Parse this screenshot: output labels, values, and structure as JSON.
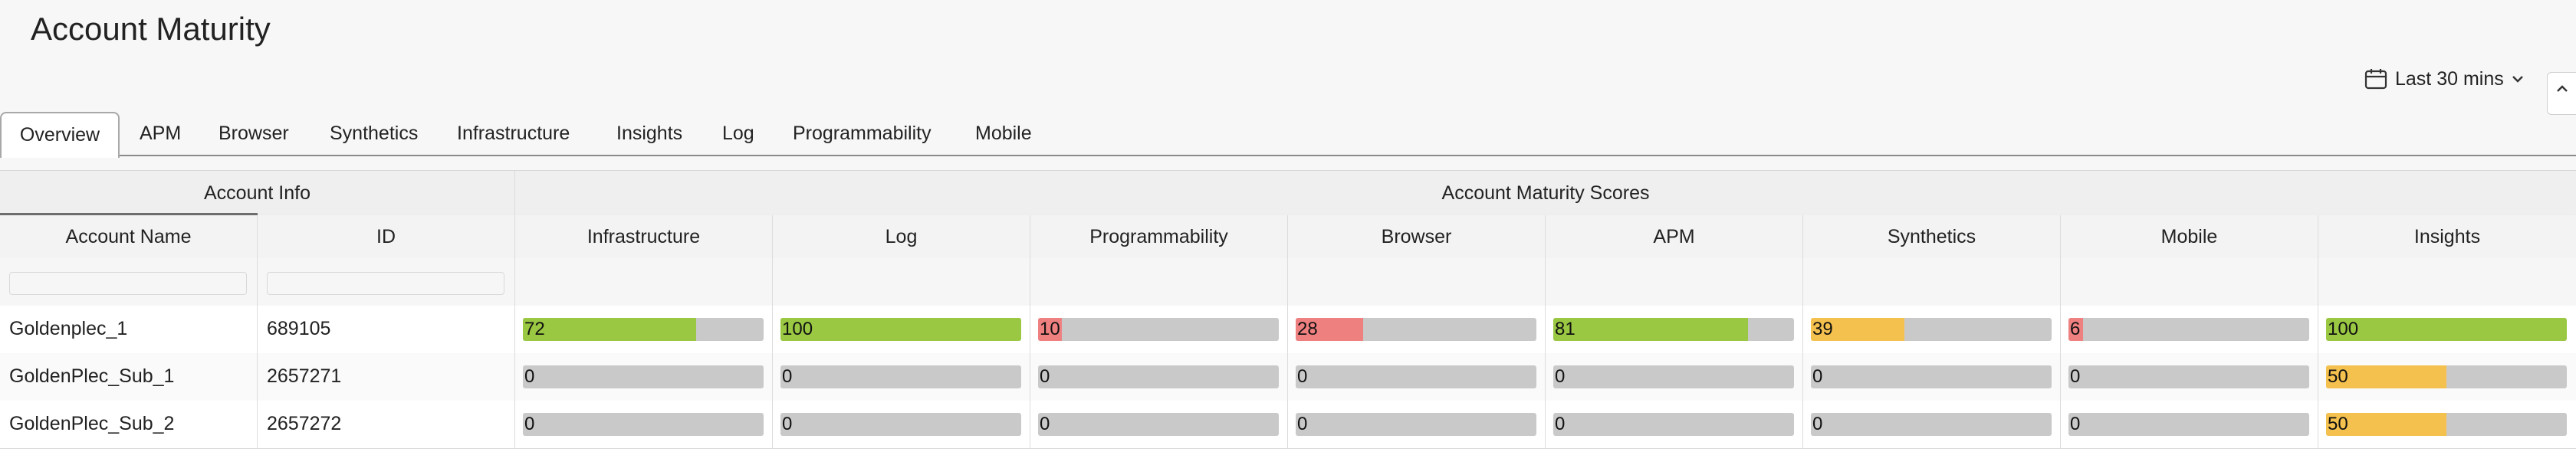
{
  "page": {
    "title": "Account Maturity"
  },
  "time_picker": {
    "label": "Last 30 mins",
    "icon": "calendar-icon"
  },
  "tabs": [
    {
      "label": "Overview",
      "active": true
    },
    {
      "label": "APM"
    },
    {
      "label": "Browser"
    },
    {
      "label": "Synthetics"
    },
    {
      "label": "Infrastructure"
    },
    {
      "label": "Insights"
    },
    {
      "label": "Log"
    },
    {
      "label": "Programmability"
    },
    {
      "label": "Mobile"
    }
  ],
  "grid": {
    "groups": {
      "account_info": "Account Info",
      "maturity_scores": "Account Maturity Scores"
    },
    "columns": {
      "account_name": "Account Name",
      "id": "ID",
      "scores": [
        "Infrastructure",
        "Log",
        "Programmability",
        "Browser",
        "APM",
        "Synthetics",
        "Mobile",
        "Insights"
      ]
    },
    "rows": [
      {
        "name": "Goldenplec_1",
        "id": "689105",
        "scores": [
          72,
          100,
          10,
          28,
          81,
          39,
          6,
          100
        ]
      },
      {
        "name": "GoldenPlec_Sub_1",
        "id": "2657271",
        "scores": [
          0,
          0,
          0,
          0,
          0,
          0,
          0,
          50
        ]
      },
      {
        "name": "GoldenPlec_Sub_2",
        "id": "2657272",
        "scores": [
          0,
          0,
          0,
          0,
          0,
          0,
          0,
          50
        ]
      }
    ]
  },
  "colors": {
    "high": "#9ac843",
    "mid": "#f5c14e",
    "low": "#ee8080",
    "track": "#c9c9c9"
  }
}
